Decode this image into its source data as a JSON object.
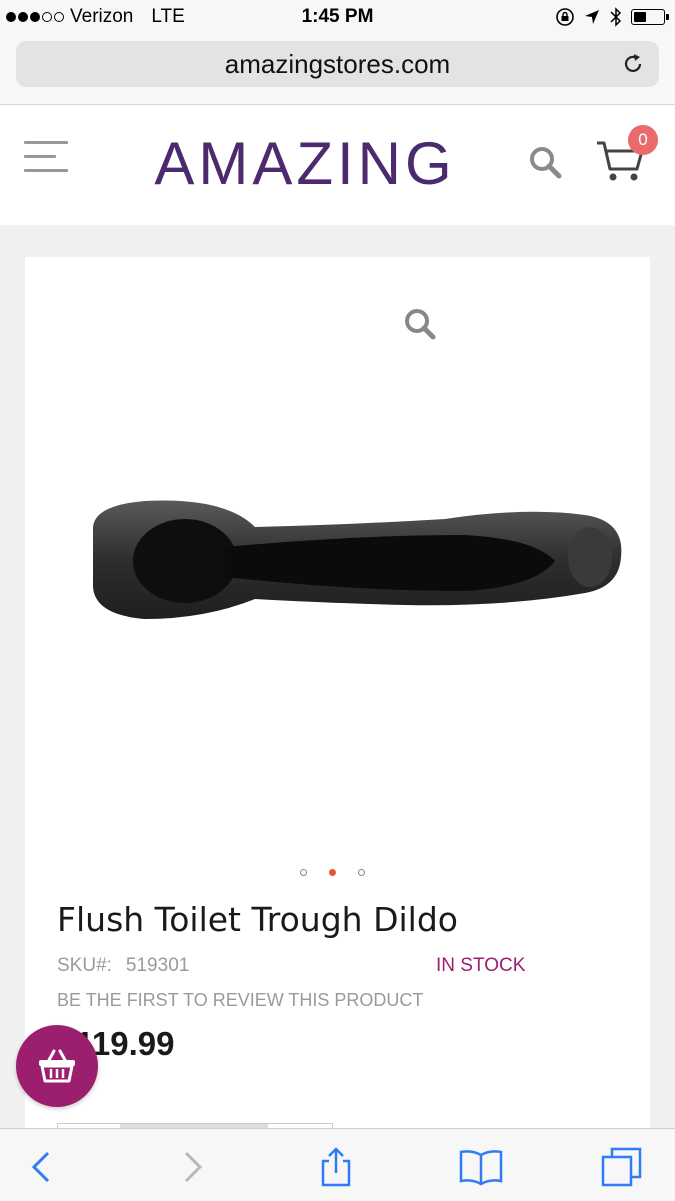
{
  "status_bar": {
    "carrier": "Verizon",
    "network": "LTE",
    "time": "1:45 PM",
    "signal_bars_filled": 3,
    "signal_bars_total": 5
  },
  "browser": {
    "url": "amazingstores.com"
  },
  "header": {
    "logo": "AMAZING",
    "cart_count": "0"
  },
  "product": {
    "title": "Flush Toilet Trough Dildo",
    "sku_label": "SKU#:",
    "sku": "519301",
    "stock_status": "IN STOCK",
    "review_prompt": "BE THE FIRST TO REVIEW THIS PRODUCT",
    "price": "$119.99",
    "carousel_total": 3,
    "carousel_active_index": 1
  },
  "colors": {
    "brand_purple": "#4b2a6e",
    "accent_magenta": "#9c1f6f",
    "badge_red": "#ea6b6b",
    "carousel_active": "#e4572e",
    "ios_blue": "#2f7cf6"
  },
  "icons": {
    "menu": "hamburger-icon",
    "search": "search-icon",
    "cart": "cart-icon",
    "zoom": "zoom-icon",
    "basket": "basket-icon",
    "back": "back-chevron-icon",
    "forward": "forward-chevron-icon",
    "share": "share-icon",
    "bookmarks": "bookmarks-icon",
    "tabs": "tabs-icon"
  }
}
